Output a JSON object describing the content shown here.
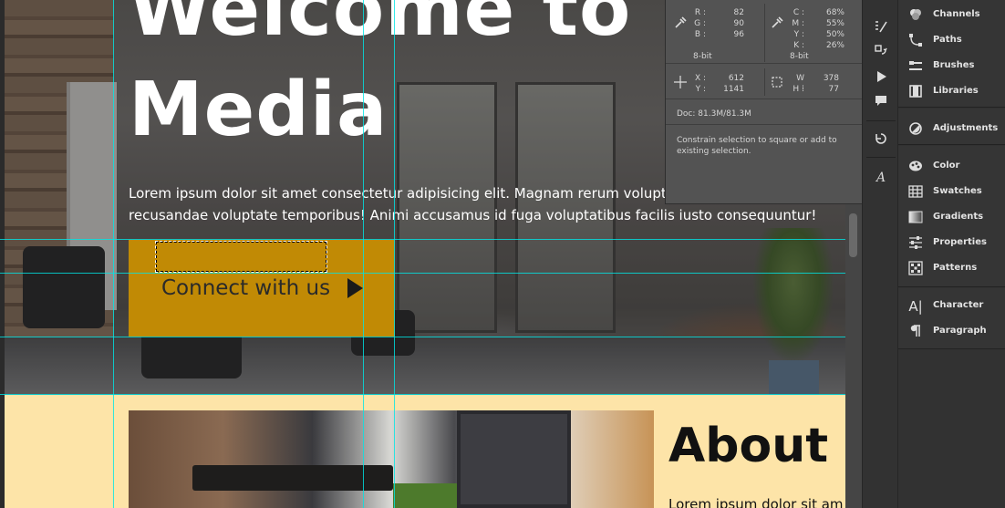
{
  "document": {
    "hero": {
      "title_line1": "Welcome to Th",
      "title_line2": "Media",
      "paragraph_line1": "Lorem ipsum dolor sit amet consectetur adipisicing elit. Magnam rerum voluptat",
      "paragraph_line2": "recusandae voluptate temporibus! Animi accusamus id fuga voluptatibus facilis iusto consequuntur!",
      "cta_label": "Connect with us"
    },
    "about": {
      "title": "About U",
      "text": "Lorem ipsum dolor sit am"
    }
  },
  "info_panel": {
    "rgb": {
      "r_label": "R :",
      "r": "82",
      "g_label": "G :",
      "g": "90",
      "b_label": "B :",
      "b": "96",
      "bit": "8-bit"
    },
    "cmyk": {
      "c_label": "C :",
      "c": "68%",
      "m_label": "M :",
      "m": "55%",
      "y_label": "Y :",
      "y": "50%",
      "k_label": "K :",
      "k": "26%",
      "bit": "8-bit"
    },
    "pos": {
      "x_label": "X :",
      "x": "612",
      "y_label": "Y :",
      "y": "1141"
    },
    "size": {
      "w_label": "W :",
      "w": "378",
      "h_label": "H :",
      "h": "77"
    },
    "doc": "Doc: 81.3M/81.3M",
    "hint": "Constrain selection to square or add to existing selection."
  },
  "tool_strip": [
    {
      "name": "history-brush-tool",
      "icon": "☰"
    },
    {
      "name": "transform-tool",
      "icon": "⇄"
    },
    {
      "name": "play-action-tool",
      "icon": "▶"
    },
    {
      "name": "comment-tool",
      "icon": "✉"
    },
    {
      "name": "history-tool",
      "icon": "↺"
    },
    {
      "name": "glyphs-tool",
      "icon": "A"
    }
  ],
  "panels": {
    "group1": [
      "Channels",
      "Paths",
      "Brushes",
      "Libraries"
    ],
    "group2": [
      "Adjustments"
    ],
    "group3": [
      "Color",
      "Swatches",
      "Gradients",
      "Properties",
      "Patterns"
    ],
    "group4": [
      "Character",
      "Paragraph"
    ]
  },
  "panel_icons": {
    "channels": "channels-icon",
    "paths": "paths-icon",
    "brushes": "brushes-icon",
    "libraries": "libraries-icon",
    "adjustments": "adjustments-icon",
    "color": "color-icon",
    "swatches": "swatches-icon",
    "gradients": "gradients-icon",
    "properties": "properties-icon",
    "patterns": "patterns-icon",
    "character": "character-icon",
    "paragraph": "paragraph-icon"
  },
  "colors": {
    "cta_background": "#c18a05",
    "about_background": "#fde4a8",
    "guide": "#00e6e6",
    "panel_background": "#535353"
  }
}
